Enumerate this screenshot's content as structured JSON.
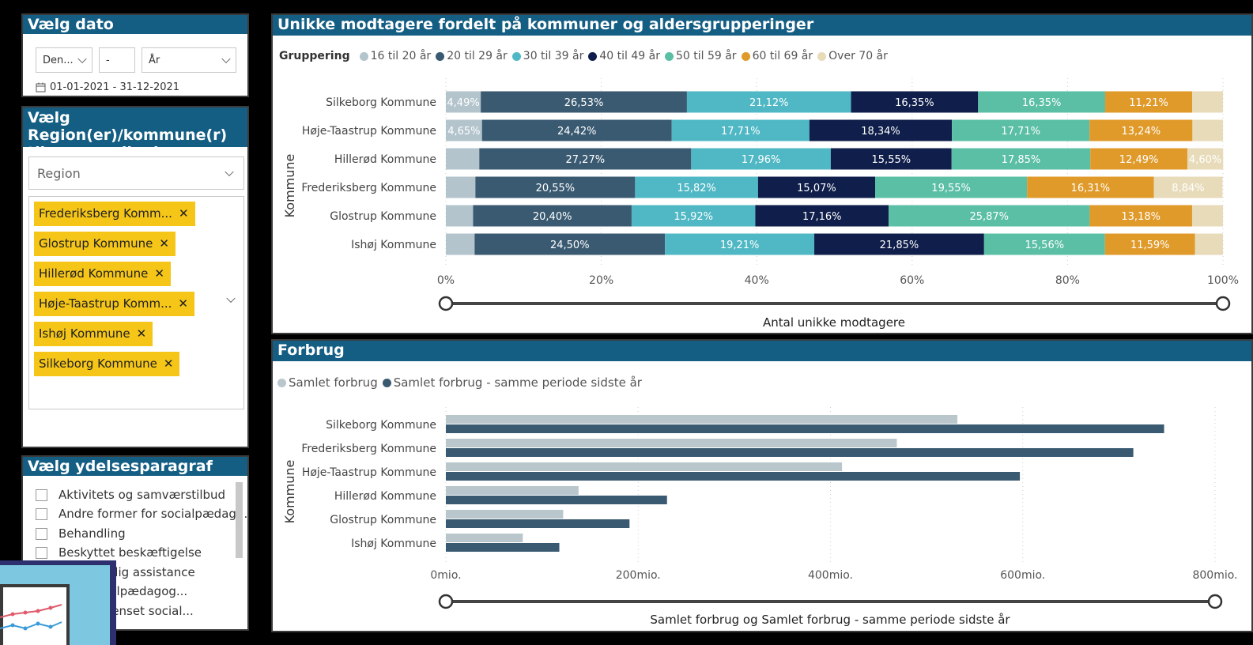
{
  "date_panel": {
    "title": "Vælg dato",
    "month_value": "Den...",
    "separator": "-",
    "year_value": "År",
    "range_text": "01-01-2021 - 31-12-2021"
  },
  "region_panel": {
    "title_line1": "Vælg Region(er)/kommune(r)",
    "title_line2": "til sammenligning",
    "region_placeholder": "Region",
    "selected": [
      "Frederiksberg Komm...",
      "Glostrup Kommune",
      "Hillerød Kommune",
      "Høje-Taastrup Komm...",
      "Ishøj Kommune",
      "Silkeborg Kommune"
    ],
    "remove_glyph": "✕"
  },
  "ydelse_panel": {
    "title": "Vælg ydelsesparagraf",
    "items": [
      "Aktivitets og samværstilbud",
      "Andre former for socialpædag...",
      "Behandling",
      "Beskyttet beskæftigelse",
      "et personlig assistance",
      "eret socialpædagog...",
      "tidsbegrænset social..."
    ]
  },
  "colors": {
    "header": "#145e84",
    "chip": "#f5c518",
    "g16": "#b3c4cc",
    "g20": "#3a5a72",
    "g30": "#4fb8c4",
    "g40": "#0f1e4a",
    "g50": "#5bbfa6",
    "g60": "#e09a2a",
    "g70": "#e8dbb9",
    "cur": "#b9c6cc",
    "prev": "#3a5a72"
  },
  "chart1": {
    "title": "Unikke modtagere fordelt på kommuner og aldersgrupperinger",
    "legend_title": "Gruppering",
    "ylabel": "Kommune",
    "xlabel": "Antal unikke modtagere",
    "ticks": [
      "0%",
      "20%",
      "40%",
      "60%",
      "80%",
      "100%"
    ]
  },
  "chart2": {
    "title": "Forbrug",
    "ylabel": "Kommune",
    "xlabel": "Samlet forbrug og Samlet forbrug - samme periode sidste år",
    "ticks": [
      "0mio.",
      "200mio.",
      "400mio.",
      "600mio.",
      "800mio."
    ]
  },
  "chart_data": [
    {
      "type": "bar",
      "orientation": "horizontal-stacked-100",
      "categories": [
        "Silkeborg Kommune",
        "Høje-Taastrup Kommune",
        "Hillerød Kommune",
        "Frederiksberg Kommune",
        "Glostrup Kommune",
        "Ishøj Kommune"
      ],
      "series": [
        {
          "name": "16 til 20 år",
          "values": [
            4.49,
            4.65,
            4.3,
            3.8,
            3.5,
            3.7
          ],
          "labels": [
            "4,49%",
            "4,65%",
            "",
            "",
            "",
            ""
          ]
        },
        {
          "name": "20 til 29 år",
          "values": [
            26.53,
            24.42,
            27.27,
            20.55,
            20.4,
            24.5
          ],
          "labels": [
            "26,53%",
            "24,42%",
            "27,27%",
            "20,55%",
            "20,40%",
            "24,50%"
          ]
        },
        {
          "name": "30 til 39 år",
          "values": [
            21.12,
            17.71,
            17.96,
            15.82,
            15.92,
            19.21
          ],
          "labels": [
            "21,12%",
            "17,71%",
            "17,96%",
            "15,82%",
            "15,92%",
            "19,21%"
          ]
        },
        {
          "name": "40 til 49 år",
          "values": [
            16.35,
            18.34,
            15.55,
            15.07,
            17.16,
            21.85
          ],
          "labels": [
            "16,35%",
            "18,34%",
            "15,55%",
            "15,07%",
            "17,16%",
            "21,85%"
          ]
        },
        {
          "name": "50 til 59 år",
          "values": [
            16.35,
            17.71,
            17.85,
            19.55,
            25.87,
            15.56
          ],
          "labels": [
            "16,35%",
            "17,71%",
            "17,85%",
            "19,55%",
            "25,87%",
            "15,56%"
          ]
        },
        {
          "name": "60 til 69 år",
          "values": [
            11.21,
            13.24,
            12.49,
            16.31,
            13.18,
            11.59
          ],
          "labels": [
            "11,21%",
            "13,24%",
            "12,49%",
            "16,31%",
            "13,18%",
            "11,59%"
          ]
        },
        {
          "name": "Over 70 år",
          "values": [
            3.95,
            3.93,
            4.6,
            8.84,
            3.97,
            3.59
          ],
          "labels": [
            "",
            "",
            "4,60%",
            "8,84%",
            "",
            ""
          ]
        }
      ],
      "xlim": [
        0,
        100
      ]
    },
    {
      "type": "bar",
      "orientation": "horizontal-grouped",
      "categories": [
        "Silkeborg Kommune",
        "Frederiksberg Kommune",
        "Høje-Taastrup Kommune",
        "Hillerød Kommune",
        "Glostrup Kommune",
        "Ishøj Kommune"
      ],
      "series": [
        {
          "name": "Samlet forbrug",
          "values": [
            532,
            469,
            412,
            138,
            122,
            80
          ]
        },
        {
          "name": "Samlet forbrug - samme periode sidste år",
          "values": [
            747,
            715,
            597,
            230,
            191,
            118
          ]
        }
      ],
      "xlim": [
        0,
        800
      ],
      "unit": "mio."
    }
  ]
}
